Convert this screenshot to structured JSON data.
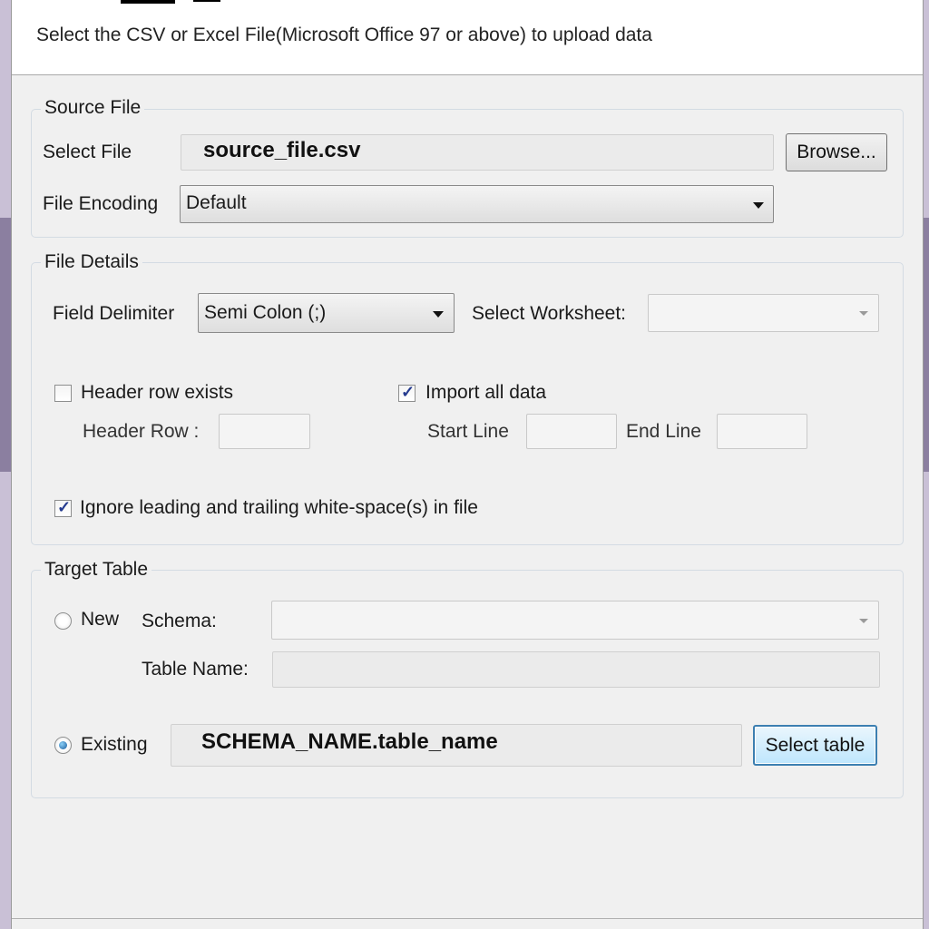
{
  "header": {
    "description": "Select the CSV or Excel File(Microsoft Office 97 or above) to upload data"
  },
  "source_file": {
    "group_title": "Source File",
    "select_file_label": "Select File",
    "file_value": "source_file.csv",
    "browse_label": "Browse...",
    "encoding_label": "File Encoding",
    "encoding_value": "Default"
  },
  "file_details": {
    "group_title": "File Details",
    "delimiter_label": "Field Delimiter",
    "delimiter_value": "Semi Colon (;)",
    "worksheet_label": "Select Worksheet:",
    "worksheet_value": "",
    "header_row_exists_label": "Header row exists",
    "header_row_exists_checked": false,
    "header_row_label": "Header Row :",
    "header_row_value": "",
    "import_all_label": "Import all data",
    "import_all_checked": true,
    "start_line_label": "Start Line",
    "start_line_value": "",
    "end_line_label": "End Line",
    "end_line_value": "",
    "ignore_whitespace_label": "Ignore leading and trailing white-space(s) in file",
    "ignore_whitespace_checked": true
  },
  "target_table": {
    "group_title": "Target Table",
    "new_label": "New",
    "new_selected": false,
    "schema_label": "Schema:",
    "schema_value": "",
    "table_name_label": "Table Name:",
    "table_name_value": "",
    "existing_label": "Existing",
    "existing_selected": true,
    "existing_value": "SCHEMA_NAME.table_name",
    "select_table_label": "Select table"
  },
  "icons": {
    "dropdown": "chevron-down-icon",
    "check": "checkmark-icon"
  },
  "colors": {
    "window_bg": "#f0f0f0",
    "header_bg": "#ffffff",
    "focus_border": "#3c7fb1",
    "check_color": "#243a8f"
  }
}
